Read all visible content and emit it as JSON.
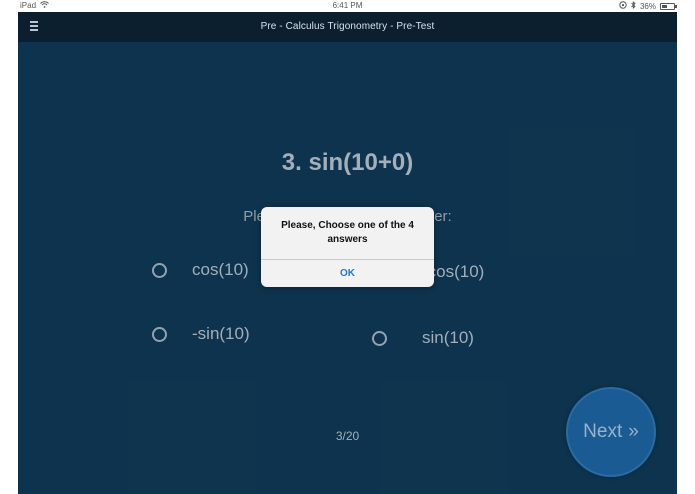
{
  "status": {
    "device": "iPad",
    "time": "6:41 PM",
    "battery": "36%",
    "wifi_icon": "wifi-icon",
    "bluetooth_icon": "bluetooth-icon",
    "rotation_lock_icon": "rotation-lock-icon"
  },
  "nav": {
    "title": "Pre - Calculus Trigonometry - Pre-Test",
    "menu_icon": "hamburger-menu-icon"
  },
  "quiz": {
    "question": "3. sin(10+0)",
    "prompt": "Please pick the correct answer:",
    "options": [
      "cos(10)",
      "-cos(10)",
      "-sin(10)",
      "sin(10)"
    ],
    "progress": "3/20",
    "next_label": "Next",
    "next_icon": "double-chevron-right-icon"
  },
  "alert": {
    "message": "Please, Choose one of the 4 answers",
    "ok_label": "OK"
  },
  "colors": {
    "background": "#0e3550",
    "navbar": "#0b1f2f",
    "next_button": "#1c5d97",
    "alert_link": "#1a7ad8"
  }
}
